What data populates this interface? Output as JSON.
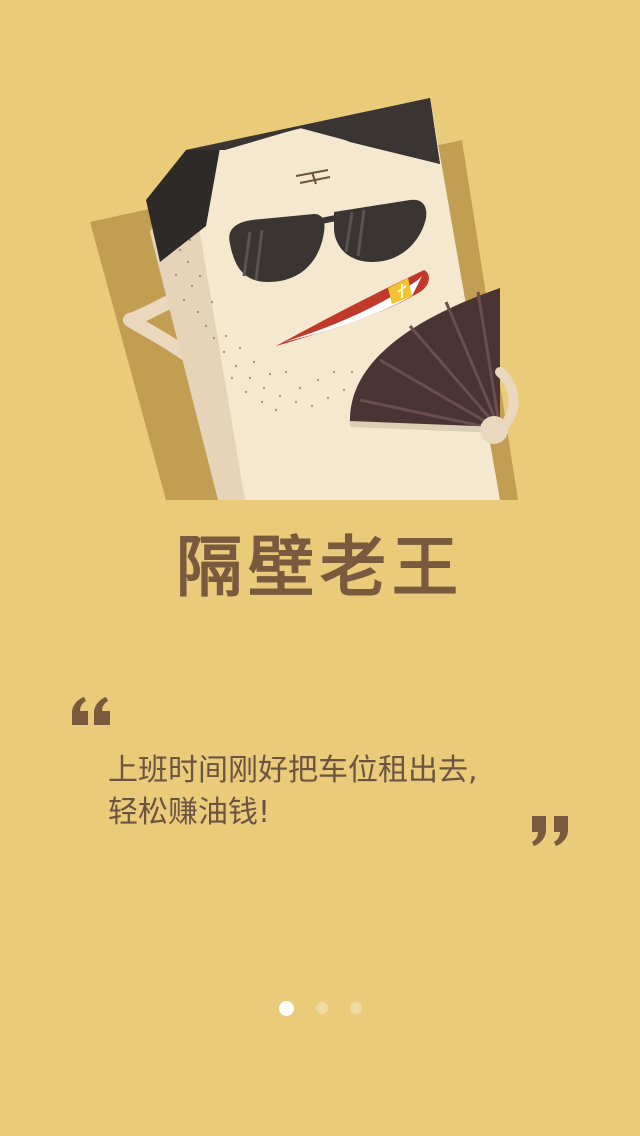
{
  "onboarding": {
    "title": "隔壁老王",
    "quote_line_1": "上班时间刚好把车位租出去,",
    "quote_line_2": "轻松赚油钱!",
    "illustration_icon": "character-with-sunglasses-and-fan-illustration",
    "quote_open_icon": "open-quote-icon",
    "quote_close_icon": "close-quote-icon"
  },
  "pager": {
    "current_page": 1,
    "total_pages": 3
  },
  "colors": {
    "background": "#E9CB7A",
    "title": "#7A5A3E",
    "text": "#6B5440",
    "dot_active": "#FFFFFF",
    "dot_inactive": "#F0DC9E"
  }
}
